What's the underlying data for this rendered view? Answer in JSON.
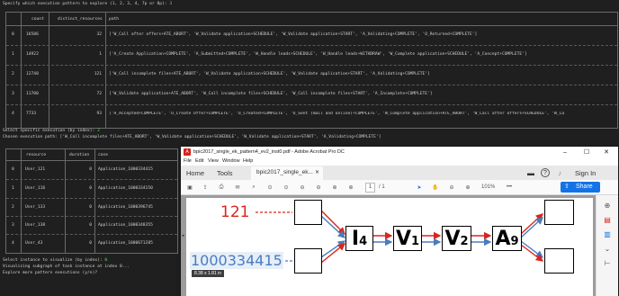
{
  "terminal": {
    "prompt1": "Specify which execution pattern to explore (1, 2, 3, 4, 7p or 8p):",
    "prompt1_answer": "3",
    "table1": {
      "headers": [
        "",
        "count",
        "distinct_resources",
        "path"
      ],
      "rows": [
        [
          "0",
          "16586",
          "32",
          "['W_Call after offers+ATE_ABORT', 'W_Validate application+SCHEDULE', 'W_Validate application+START', 'A_Validating+COMPLETE', 'O_Returned+COMPLETE']"
        ],
        [
          "1",
          "14922",
          "1",
          "['A_Create Application+COMPLETE', 'A_Submitted+COMPLETE', 'W_Handle leads+SCHEDULE', 'W_Handle leads+WITHDRAW', 'W_Complete application+SCHEDULE', 'A_Concept+COMPLETE']"
        ],
        [
          "2",
          "12748",
          "121",
          "['W_Call incomplete files+ATE_ABORT', 'W_Validate application+SCHEDULE', 'W_Validate application+START', 'A_Validating+COMPLETE']"
        ],
        [
          "3",
          "11700",
          "72",
          "['W_Validate application+ATE_ABORT', 'W_Call incomplete files+SCHEDULE', 'W_Call incomplete files+START', 'A_Incomplete+COMPLETE']"
        ],
        [
          "4",
          "7733",
          "93",
          "['A_Accepted+COMPLETE', 'O_Create Offer+COMPLETE', 'O_Created+COMPLETE', 'O_Sent (mail and online)+COMPLETE', 'W_Complete application+ATE_ABORT', 'W_Call after offers+SCHEDULE', 'W_Ca"
        ]
      ]
    },
    "prompt2": "Select specific execution (by index):",
    "prompt2_answer": "2",
    "chosen_path": "Chosen execution path: ['W_Call incomplete files+ATE_ABORT', 'W_Validate application+SCHEDULE', 'W_Validate application+START', 'A_Validating+COMPLETE']",
    "table2": {
      "headers": [
        "",
        "resource",
        "duration",
        "case"
      ],
      "rows": [
        [
          "0",
          "User_121",
          "0",
          "Application_1000334415"
        ],
        [
          "1",
          "User_116",
          "0",
          "Application_1000334150"
        ],
        [
          "2",
          "User_133",
          "0",
          "Application_1000396745"
        ],
        [
          "3",
          "User_138",
          "0",
          "Application_1000348355"
        ],
        [
          "4",
          "User_43",
          "0",
          "Application_1000671285"
        ]
      ]
    },
    "prompt3": "Select instance to visualize (by index):",
    "prompt3_answer": "0",
    "visualizing": "Visualizing subgraph of task instance at index 0...",
    "prompt4": "Explore more pattern executions (y/n)?"
  },
  "acrobat": {
    "title": "bpic2017_single_ek_pattern4_ev2_inst0.pdf - Adobe Acrobat Pro DC",
    "menu": [
      "File",
      "Edit",
      "View",
      "Window",
      "Help"
    ],
    "tabs": {
      "home": "Home",
      "tools": "Tools",
      "doc": "bpic2017_single_ek..."
    },
    "sign_in": "Sign In",
    "share": "Share",
    "page_current": "1",
    "page_total": "/ 1",
    "zoom": "101%",
    "tooltip": "8.38 x 1.81 in",
    "graph": {
      "resource_label": "121",
      "case_label": "1000334415",
      "nodes": [
        "I",
        "V",
        "V",
        "A"
      ],
      "subs": [
        "4",
        "1",
        "2",
        "9"
      ]
    },
    "colors": {
      "red": "#d9261c",
      "blue": "#4a7cbf"
    }
  }
}
